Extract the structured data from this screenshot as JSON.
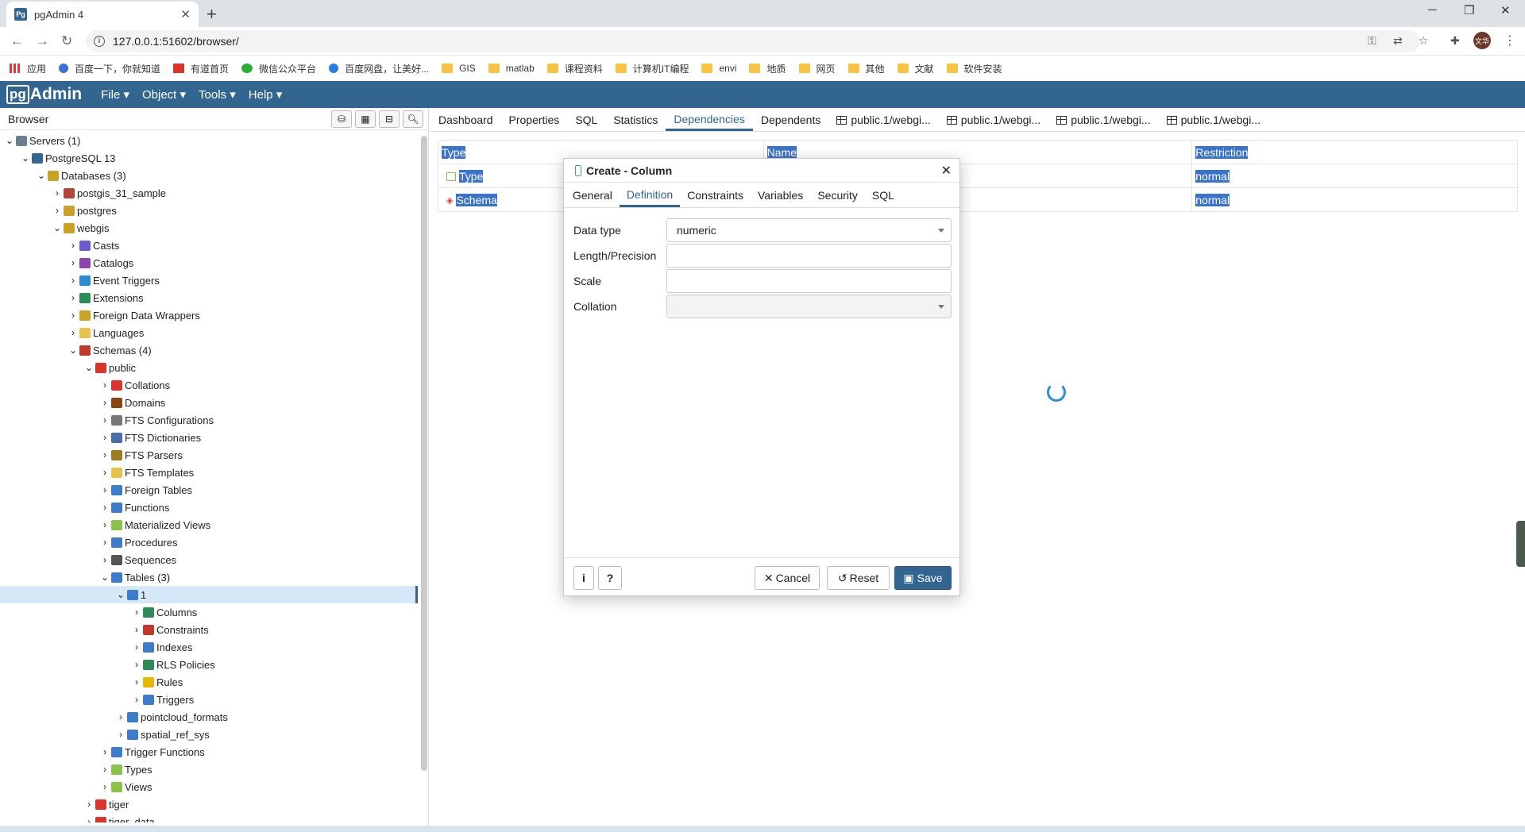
{
  "browser": {
    "tab_title": "pgAdmin 4",
    "url": "127.0.0.1:51602/browser/",
    "avatar_text": "文华",
    "bookmarks": [
      "应用",
      "百度一下，你就知道",
      "有道首页",
      "微信公众平台",
      "百度网盘，让美好...",
      "GIS",
      "matlab",
      "课程资料",
      "计算机IT编程",
      "envi",
      "地质",
      "网页",
      "其他",
      "文献",
      "软件安装"
    ]
  },
  "app": {
    "logo_a": "pg",
    "logo_b": "Admin",
    "menus": [
      "File",
      "Object",
      "Tools",
      "Help"
    ]
  },
  "left_panel": {
    "title": "Browser",
    "tree": [
      {
        "label": "Servers (1)",
        "level": 0,
        "expanded": true
      },
      {
        "label": "PostgreSQL 13",
        "level": 1,
        "expanded": true
      },
      {
        "label": "Databases (3)",
        "level": 2,
        "expanded": true
      },
      {
        "label": "postgis_31_sample",
        "level": 3,
        "expanded": false
      },
      {
        "label": "postgres",
        "level": 3,
        "expanded": false
      },
      {
        "label": "webgis",
        "level": 3,
        "expanded": true
      },
      {
        "label": "Casts",
        "level": 4,
        "expanded": false
      },
      {
        "label": "Catalogs",
        "level": 4,
        "expanded": false
      },
      {
        "label": "Event Triggers",
        "level": 4,
        "expanded": false
      },
      {
        "label": "Extensions",
        "level": 4,
        "expanded": false
      },
      {
        "label": "Foreign Data Wrappers",
        "level": 4,
        "expanded": false
      },
      {
        "label": "Languages",
        "level": 4,
        "expanded": false
      },
      {
        "label": "Schemas (4)",
        "level": 4,
        "expanded": true
      },
      {
        "label": "public",
        "level": 5,
        "expanded": true
      },
      {
        "label": "Collations",
        "level": 6,
        "expanded": false
      },
      {
        "label": "Domains",
        "level": 6,
        "expanded": false
      },
      {
        "label": "FTS Configurations",
        "level": 6,
        "expanded": false
      },
      {
        "label": "FTS Dictionaries",
        "level": 6,
        "expanded": false
      },
      {
        "label": "FTS Parsers",
        "level": 6,
        "expanded": false
      },
      {
        "label": "FTS Templates",
        "level": 6,
        "expanded": false
      },
      {
        "label": "Foreign Tables",
        "level": 6,
        "expanded": false
      },
      {
        "label": "Functions",
        "level": 6,
        "expanded": false
      },
      {
        "label": "Materialized Views",
        "level": 6,
        "expanded": false
      },
      {
        "label": "Procedures",
        "level": 6,
        "expanded": false
      },
      {
        "label": "Sequences",
        "level": 6,
        "expanded": false
      },
      {
        "label": "Tables (3)",
        "level": 6,
        "expanded": true
      },
      {
        "label": "1",
        "level": 7,
        "expanded": true,
        "selected": true
      },
      {
        "label": "Columns",
        "level": 8,
        "expanded": false
      },
      {
        "label": "Constraints",
        "level": 8,
        "expanded": false
      },
      {
        "label": "Indexes",
        "level": 8,
        "expanded": false
      },
      {
        "label": "RLS Policies",
        "level": 8,
        "expanded": false
      },
      {
        "label": "Rules",
        "level": 8,
        "expanded": false
      },
      {
        "label": "Triggers",
        "level": 8,
        "expanded": false
      },
      {
        "label": "pointcloud_formats",
        "level": 7,
        "expanded": false
      },
      {
        "label": "spatial_ref_sys",
        "level": 7,
        "expanded": false
      },
      {
        "label": "Trigger Functions",
        "level": 6,
        "expanded": false
      },
      {
        "label": "Types",
        "level": 6,
        "expanded": false
      },
      {
        "label": "Views",
        "level": 6,
        "expanded": false
      },
      {
        "label": "tiger",
        "level": 5,
        "expanded": false
      },
      {
        "label": "tiger_data",
        "level": 5,
        "expanded": false
      }
    ]
  },
  "right_panel": {
    "tabs": [
      {
        "label": "Dashboard",
        "active": false,
        "grid": false
      },
      {
        "label": "Properties",
        "active": false,
        "grid": false
      },
      {
        "label": "SQL",
        "active": false,
        "grid": false
      },
      {
        "label": "Statistics",
        "active": false,
        "grid": false
      },
      {
        "label": "Dependencies",
        "active": true,
        "grid": false
      },
      {
        "label": "Dependents",
        "active": false,
        "grid": false
      },
      {
        "label": "public.1/webgi...",
        "active": false,
        "grid": true
      },
      {
        "label": "public.1/webgi...",
        "active": false,
        "grid": true
      },
      {
        "label": "public.1/webgi...",
        "active": false,
        "grid": true
      },
      {
        "label": "public.1/webgi...",
        "active": false,
        "grid": true
      }
    ],
    "table": {
      "headers": [
        "Type",
        "Name",
        "Restriction"
      ],
      "rows": [
        {
          "type": "Type",
          "name": "",
          "restriction": "normal"
        },
        {
          "type": "Schema",
          "name": "",
          "restriction": "normal"
        }
      ]
    }
  },
  "dialog": {
    "title": "Create - Column",
    "tabs": [
      "General",
      "Definition",
      "Constraints",
      "Variables",
      "Security",
      "SQL"
    ],
    "active_tab": "Definition",
    "fields": {
      "data_type_label": "Data type",
      "data_type_value": "numeric",
      "length_label": "Length/Precision",
      "length_value": "",
      "scale_label": "Scale",
      "scale_value": "",
      "collation_label": "Collation",
      "collation_value": ""
    },
    "buttons": {
      "info": "i",
      "help": "?",
      "cancel": "Cancel",
      "reset": "Reset",
      "save": "Save"
    }
  }
}
